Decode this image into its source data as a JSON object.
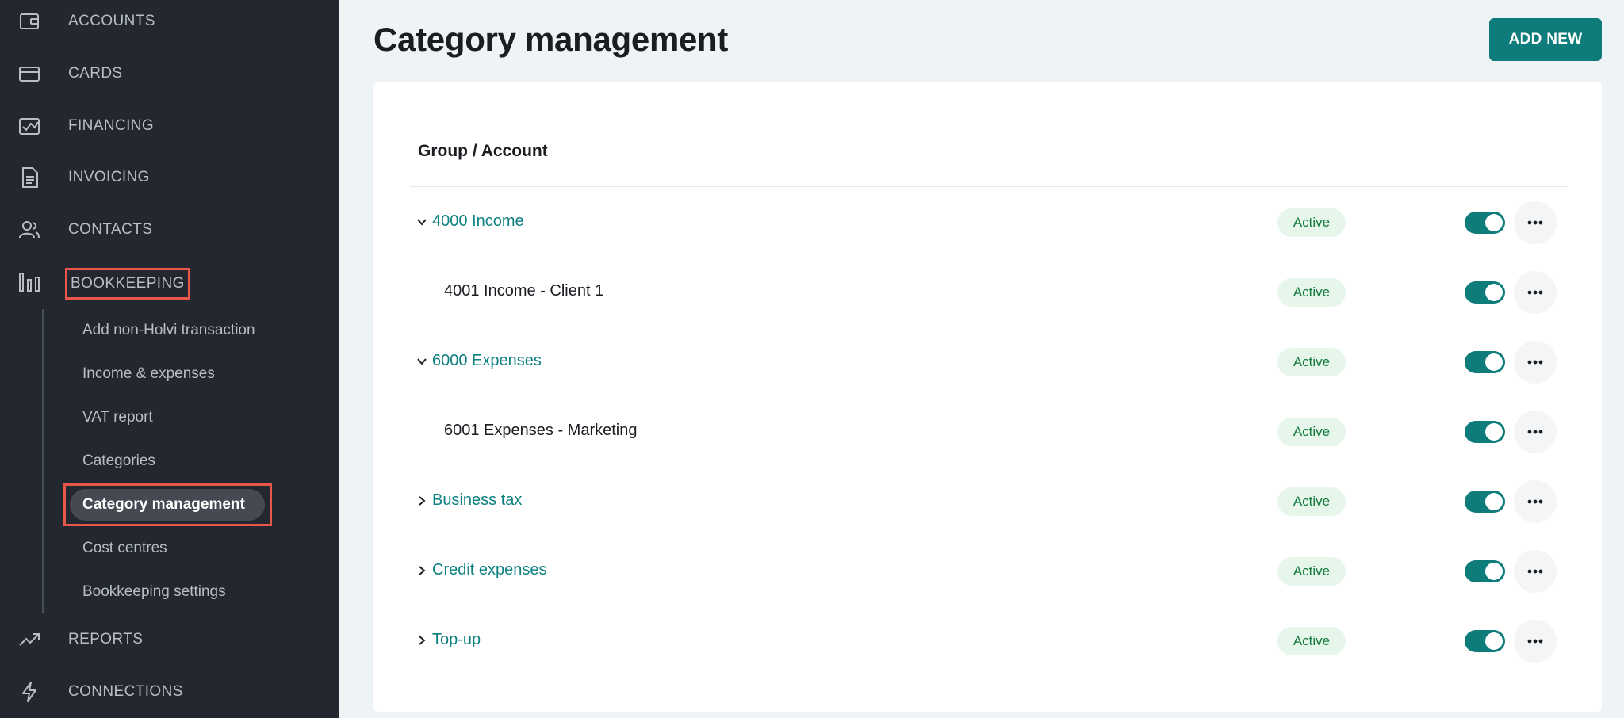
{
  "sidebar": {
    "nav": [
      {
        "label": "ACCOUNTS",
        "icon": "wallet-icon"
      },
      {
        "label": "CARDS",
        "icon": "credit-card-icon"
      },
      {
        "label": "FINANCING",
        "icon": "financing-icon"
      },
      {
        "label": "INVOICING",
        "icon": "document-icon"
      },
      {
        "label": "CONTACTS",
        "icon": "people-icon"
      },
      {
        "label": "BOOKKEEPING",
        "icon": "bar-chart-icon"
      },
      {
        "label": "REPORTS",
        "icon": "trend-up-icon"
      },
      {
        "label": "CONNECTIONS",
        "icon": "lightning-icon"
      }
    ],
    "sub_items": [
      {
        "label": "Add non-Holvi transaction"
      },
      {
        "label": "Income & expenses"
      },
      {
        "label": "VAT report"
      },
      {
        "label": "Categories"
      },
      {
        "label": "Category management"
      },
      {
        "label": "Cost centres"
      },
      {
        "label": "Bookkeeping settings"
      }
    ]
  },
  "main": {
    "title": "Category management",
    "add_button": "ADD NEW",
    "column_header": "Group / Account",
    "rows": [
      {
        "label": "4000 Income",
        "type": "group",
        "chevron": "down",
        "status": "Active"
      },
      {
        "label": "4001 Income - Client 1",
        "type": "account",
        "status": "Active"
      },
      {
        "label": "6000 Expenses",
        "type": "group",
        "chevron": "down",
        "status": "Active"
      },
      {
        "label": "6001 Expenses - Marketing",
        "type": "account",
        "status": "Active"
      },
      {
        "label": "Business tax",
        "type": "group",
        "chevron": "right",
        "status": "Active"
      },
      {
        "label": "Credit expenses",
        "type": "group",
        "chevron": "right",
        "status": "Active"
      },
      {
        "label": "Top-up",
        "type": "group",
        "chevron": "right",
        "status": "Active"
      }
    ]
  },
  "colors": {
    "sidebar_bg": "#232830",
    "accent": "#0e7c7b",
    "highlight": "#e8574a",
    "badge_bg": "#e6f6ea",
    "badge_text": "#137a3c"
  }
}
